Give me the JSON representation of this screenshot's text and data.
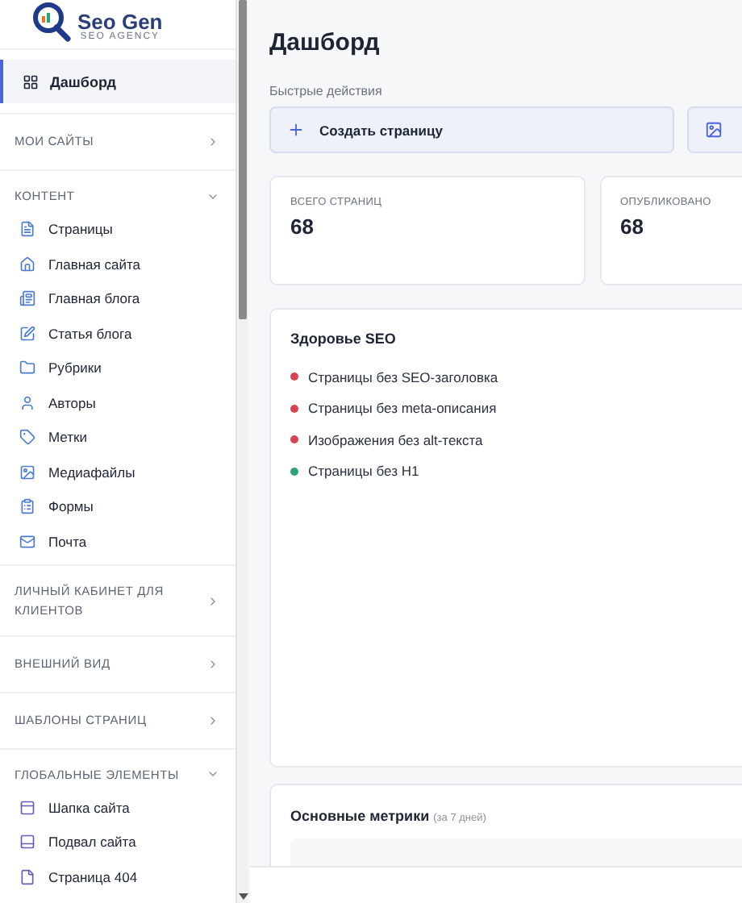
{
  "logo": {
    "name": "Seo Gen",
    "tagline": "SEO AGENCY"
  },
  "sidebar": [
    {
      "kind": "link",
      "label": "Дашборд",
      "selected": true
    },
    {
      "kind": "section",
      "label": "МОИ САЙТЫ",
      "expanded": false
    },
    {
      "kind": "section",
      "label": "КОНТЕНТ",
      "expanded": true,
      "items": [
        {
          "label": "Страницы"
        },
        {
          "label": "Главная сайта"
        },
        {
          "label": "Главная блога"
        },
        {
          "label": "Статья блога"
        },
        {
          "label": "Рубрики"
        },
        {
          "label": "Авторы"
        },
        {
          "label": "Метки"
        },
        {
          "label": "Медиафайлы"
        },
        {
          "label": "Формы"
        },
        {
          "label": "Почта"
        }
      ]
    },
    {
      "kind": "section",
      "label": "ЛИЧНЫЙ КАБИНЕТ ДЛЯ КЛИЕНТОВ",
      "expanded": false
    },
    {
      "kind": "section",
      "label": "ВНЕШНИЙ ВИД",
      "expanded": false
    },
    {
      "kind": "section",
      "label": "ШАБЛОНЫ СТРАНИЦ",
      "expanded": false
    },
    {
      "kind": "section",
      "label": "ГЛОБАЛЬНЫЕ ЭЛЕМЕНТЫ",
      "expanded": true,
      "items": [
        {
          "label": "Шапка сайта"
        },
        {
          "label": "Подвал сайта"
        },
        {
          "label": "Страница 404"
        }
      ]
    }
  ],
  "page_title": "Дашборд",
  "quick_actions": {
    "label": "Быстрые действия",
    "buttons": [
      {
        "kind": "create",
        "label": "Создать страницу"
      },
      {
        "kind": "media"
      }
    ]
  },
  "stats": [
    {
      "label": "ВСЕГО СТРАНИЦ",
      "value": "68"
    },
    {
      "label": "ОПУБЛИКОВАНО",
      "value": "68"
    }
  ],
  "seo_health": {
    "title": "Здоровье SEO",
    "items": [
      {
        "label": "Страницы без SEO-заголовка",
        "color": "#d9434f"
      },
      {
        "label": "Страницы без meta-описания",
        "color": "#d9434f"
      },
      {
        "label": "Изображения без alt-текста",
        "color": "#d9434f"
      },
      {
        "label": "Страницы без H1",
        "color": "#2aa37a"
      }
    ]
  },
  "metrics": {
    "title": "Основные метрики",
    "note": "(за 7 дней)"
  }
}
